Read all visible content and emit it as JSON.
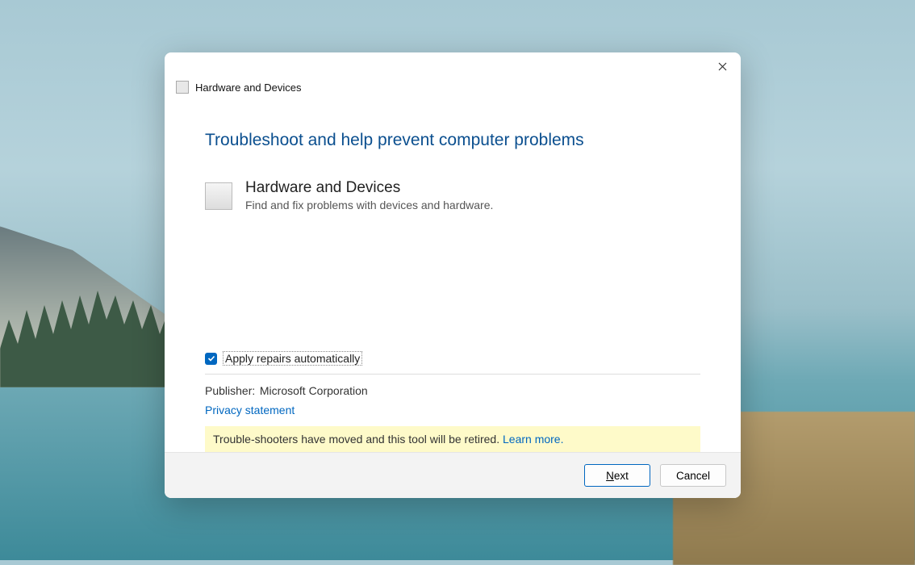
{
  "window": {
    "title": "Hardware and Devices"
  },
  "page": {
    "heading": "Troubleshoot and help prevent computer problems",
    "item_title": "Hardware and Devices",
    "item_desc": "Find and fix problems with devices and hardware."
  },
  "options": {
    "apply_repairs_label": "Apply repairs automatically",
    "apply_repairs_checked": true
  },
  "meta": {
    "publisher_label": "Publisher:",
    "publisher_value": "Microsoft Corporation",
    "privacy_link": "Privacy statement"
  },
  "notice": {
    "text": "Trouble-shooters have moved and this tool will be retired. ",
    "link": "Learn more."
  },
  "footer": {
    "next_prefix": "N",
    "next_suffix": "ext",
    "cancel": "Cancel"
  }
}
